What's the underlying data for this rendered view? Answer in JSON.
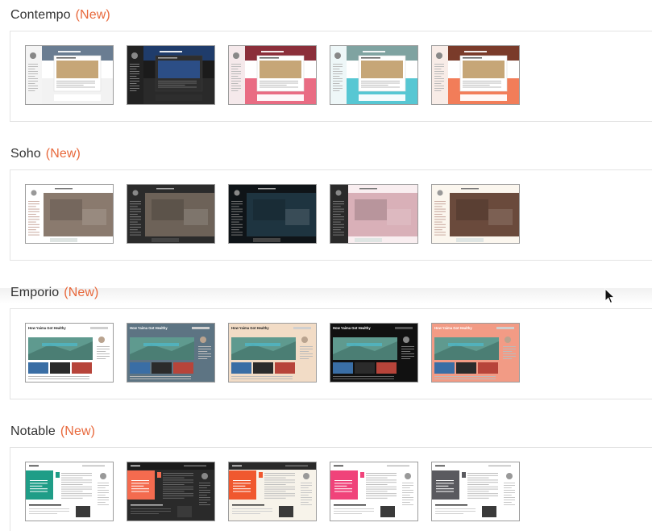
{
  "new_label": "(New)",
  "sections": [
    {
      "name": "Contempo",
      "thumbnails": [
        {
          "variant": "Contempo Light",
          "theme": "Light",
          "colors": {
            "hero": "#6a7d92",
            "accent": "#f2f2f2",
            "body": "#ffffff",
            "side": "#f4f4f4"
          }
        },
        {
          "variant": "Contempo Dark",
          "theme": "Dark",
          "colors": {
            "hero": "#1f3c6b",
            "accent": "#2a2a2a",
            "body": "#1b1b1b",
            "side": "#222222"
          }
        },
        {
          "variant": "Contempo Pink",
          "theme": "Pink",
          "colors": {
            "hero": "#8b2f3a",
            "accent": "#e96c83",
            "body": "#ffffff",
            "side": "#f5e9eb"
          }
        },
        {
          "variant": "Contempo Aqua",
          "theme": "Aqua",
          "colors": {
            "hero": "#7fa3a1",
            "accent": "#57c7d3",
            "body": "#ffffff",
            "side": "#eef7f8"
          }
        },
        {
          "variant": "Contempo Coral",
          "theme": "Coral",
          "colors": {
            "hero": "#7a3b2a",
            "accent": "#f27d59",
            "body": "#ffffff",
            "side": "#f8ece7"
          }
        }
      ]
    },
    {
      "name": "Soho",
      "thumbnails": [
        {
          "variant": "Soho Light",
          "theme": "Light",
          "colors": {
            "hero": "#8a7a6e",
            "accent": "#ffffff",
            "body": "#ffffff",
            "side": "#ffffff"
          }
        },
        {
          "variant": "Soho Dark",
          "theme": "Dark",
          "colors": {
            "hero": "#6d6258",
            "accent": "#2b2b2b",
            "body": "#2b2b2b",
            "side": "#2b2b2b"
          }
        },
        {
          "variant": "Soho Midnight",
          "theme": "Midnight",
          "colors": {
            "hero": "#1e3440",
            "accent": "#0f1418",
            "body": "#0f1418",
            "side": "#0f1418"
          }
        },
        {
          "variant": "Soho Pink",
          "theme": "Pink",
          "colors": {
            "hero": "#d9b0b8",
            "accent": "#f6e4e8",
            "body": "#f9eef0",
            "side": "#2a2a2a"
          }
        },
        {
          "variant": "Soho Cream",
          "theme": "Cream",
          "colors": {
            "hero": "#6a4a3c",
            "accent": "#fbf6ee",
            "body": "#fbf6ee",
            "side": "#fbf6ee"
          }
        }
      ]
    },
    {
      "name": "Emporio",
      "thumbnails": [
        {
          "variant": "Emporio Light",
          "theme": "Light",
          "colors": {
            "hero": "#5f9a8f",
            "accent": "#ffffff",
            "body": "#ffffff",
            "side": "#ffffff",
            "header": "#ffffff",
            "title": "#222222"
          }
        },
        {
          "variant": "Emporio Slate",
          "theme": "Slate",
          "colors": {
            "hero": "#5f9a8f",
            "accent": "#5d7483",
            "body": "#5d7483",
            "side": "#5d7483",
            "header": "#5d7483",
            "title": "#ffffff"
          }
        },
        {
          "variant": "Emporio Beige",
          "theme": "Beige",
          "colors": {
            "hero": "#5f9a8f",
            "accent": "#f2dcc6",
            "body": "#f2dcc6",
            "side": "#f2dcc6",
            "header": "#f2dcc6",
            "title": "#222222"
          }
        },
        {
          "variant": "Emporio Dark",
          "theme": "Dark",
          "colors": {
            "hero": "#5f9a8f",
            "accent": "#111111",
            "body": "#111111",
            "side": "#111111",
            "header": "#111111",
            "title": "#ffffff"
          }
        },
        {
          "variant": "Emporio Coral",
          "theme": "Coral",
          "colors": {
            "hero": "#5f9a8f",
            "accent": "#f29b85",
            "body": "#f29b85",
            "side": "#f29b85",
            "header": "#f29b85",
            "title": "#ffffff"
          }
        }
      ],
      "sample_title": "How Yaima Got Healthy"
    },
    {
      "name": "Notable",
      "thumbnails": [
        {
          "variant": "Notable Light",
          "theme": "Light",
          "colors": {
            "hero": "#1f9d87",
            "accent": "#ffffff",
            "body": "#ffffff",
            "side": "#ffffff",
            "header": "#ffffff"
          }
        },
        {
          "variant": "Notable Dark",
          "theme": "Dark",
          "colors": {
            "hero": "#f46b4f",
            "accent": "#2a2a2a",
            "body": "#2a2a2a",
            "side": "#2a2a2a",
            "header": "#1b1b1b"
          }
        },
        {
          "variant": "Notable Orange",
          "theme": "Orange",
          "colors": {
            "hero": "#f0582f",
            "accent": "#f7f3ea",
            "body": "#f7f3ea",
            "side": "#f7f3ea",
            "header": "#2a2a2a"
          }
        },
        {
          "variant": "Notable Pink",
          "theme": "Pink",
          "colors": {
            "hero": "#f0437a",
            "accent": "#ffffff",
            "body": "#ffffff",
            "side": "#ffffff",
            "header": "#ffffff"
          }
        },
        {
          "variant": "Notable Gray",
          "theme": "Gray",
          "colors": {
            "hero": "#5a5a5f",
            "accent": "#ffffff",
            "body": "#ffffff",
            "side": "#ffffff",
            "header": "#ffffff"
          }
        }
      ]
    }
  ],
  "colors": {
    "new_badge": "#e8683b",
    "heading": "#333333",
    "border": "#e3e3e3"
  }
}
